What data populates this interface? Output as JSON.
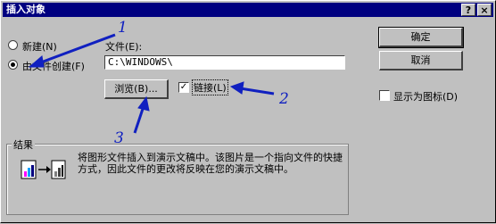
{
  "title": "插入对象",
  "title_buttons": {
    "help": "?",
    "close": "×"
  },
  "source": {
    "new_label": "新建(N)",
    "from_file_label": "由文件创建(F)",
    "selected": "from_file"
  },
  "file": {
    "label": "文件(E):",
    "value": "C:\\WINDOWS\\"
  },
  "browse_label": "浏览(B)...",
  "link": {
    "label": "链接(L)",
    "checked": true
  },
  "buttons": {
    "ok": "确定",
    "cancel": "取消"
  },
  "display_as_icon": {
    "label": "显示为图标(D)",
    "checked": false
  },
  "result": {
    "title": "结果",
    "text": "将图形文件插入到演示文稿中。该图片是一个指向文件的快捷方式，因此文件的更改将反映在您的演示文稿中。"
  },
  "annotations": [
    "1",
    "2",
    "3"
  ],
  "colors": {
    "title_bar": "#000080",
    "annotation": "#1020c0"
  }
}
